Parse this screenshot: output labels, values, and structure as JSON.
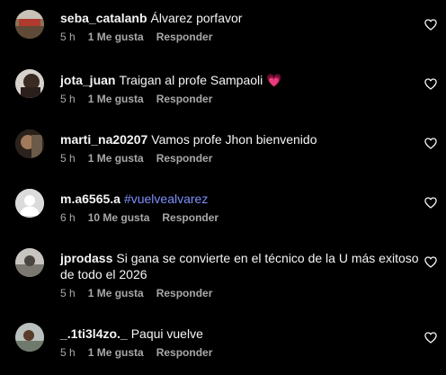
{
  "colors": {
    "background": "#000000",
    "text": "#f5f5f5",
    "meta": "#a8a8a8",
    "hashtag": "#7e8ffb",
    "emoji_heart": "#ff4f8b"
  },
  "comments": [
    {
      "username": "seba_catalanb",
      "text": "Álvarez porfavor",
      "emoji": "",
      "time": "5 h",
      "likes": "1 Me gusta",
      "reply": "Responder",
      "avatar": "photo-avatar"
    },
    {
      "username": "jota_juan",
      "text": "Traigan al profe Sampaoli",
      "emoji": "💗",
      "time": "5 h",
      "likes": "1 Me gusta",
      "reply": "Responder",
      "avatar": "photo-avatar"
    },
    {
      "username": "marti_na20207",
      "text": "Vamos profe Jhon bienvenido",
      "emoji": "",
      "time": "5 h",
      "likes": "1 Me gusta",
      "reply": "Responder",
      "avatar": "photo-avatar"
    },
    {
      "username": "m.a6565.a",
      "text": "",
      "hashtag": "#vuelvealvarez",
      "emoji": "",
      "time": "6 h",
      "likes": "10 Me gusta",
      "reply": "Responder",
      "avatar": "default-avatar"
    },
    {
      "username": "jprodass",
      "text_line1": "Si gana se convierte en el técnico de la U más exitoso",
      "text_line2": "de todo el 2026",
      "emoji": "",
      "time": "5 h",
      "likes": "1 Me gusta",
      "reply": "Responder",
      "avatar": "photo-avatar"
    },
    {
      "username": "_.1ti3l4zo._",
      "text": "Paqui vuelve",
      "emoji": "",
      "time": "5 h",
      "likes": "1 Me gusta",
      "reply": "Responder",
      "avatar": "photo-avatar"
    }
  ],
  "icons": {
    "like": "heart-outline-icon"
  }
}
